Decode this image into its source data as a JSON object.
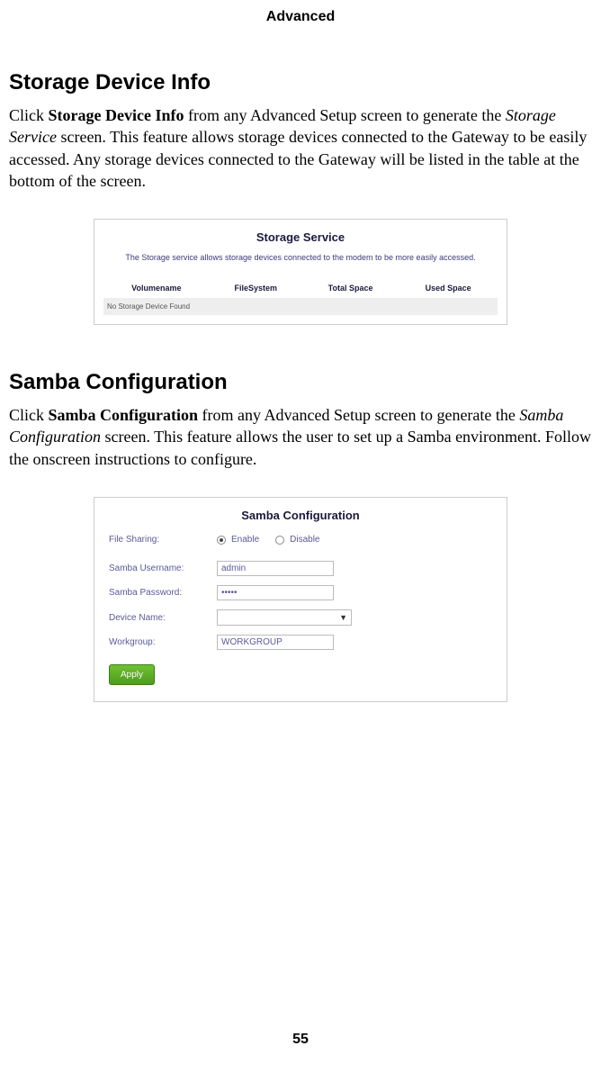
{
  "header": "Advanced",
  "pageNumber": "55",
  "section1": {
    "title": "Storage Device Info",
    "para_pre": "Click ",
    "para_bold": "Storage Device Info",
    "para_mid1": " from any Advanced Setup screen to generate the ",
    "para_italic": "Storage Service",
    "para_post": " screen. This feature allows storage devices connected to the Gateway to be easily accessed. Any storage devices connected to the Gateway will be listed in the table at the bottom of the screen."
  },
  "storageFig": {
    "title": "Storage Service",
    "desc": "The Storage service allows storage devices connected to the modem to be more easily accessed.",
    "headers": [
      "Volumename",
      "FileSystem",
      "Total Space",
      "Used Space"
    ],
    "emptyMsg": "No Storage Device Found"
  },
  "section2": {
    "title": "Samba Configuration",
    "para_pre": "Click ",
    "para_bold": "Samba Configuration",
    "para_mid1": " from any Advanced Setup screen to generate the ",
    "para_italic": "Samba Configuration",
    "para_post": " screen. This feature allows the user to set up a Samba environment. Follow the onscreen instructions to configure."
  },
  "sambaFig": {
    "title": "Samba Configuration",
    "fileSharingLabel": "File Sharing:",
    "enableLabel": "Enable",
    "disableLabel": "Disable",
    "usernameLabel": "Samba Username:",
    "usernameValue": "admin",
    "passwordLabel": "Samba Password:",
    "passwordValue": "•••••",
    "deviceNameLabel": "Device Name:",
    "deviceNameValue": "",
    "workgroupLabel": "Workgroup:",
    "workgroupValue": "WORKGROUP",
    "applyLabel": "Apply"
  }
}
